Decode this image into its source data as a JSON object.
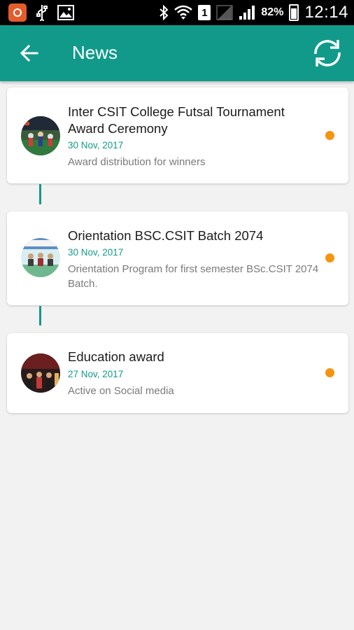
{
  "status_bar": {
    "sim_slot": "1",
    "battery": "82%",
    "time": "12:14"
  },
  "header": {
    "title": "News",
    "back_icon": "arrow-left-icon",
    "refresh_icon": "refresh-icon"
  },
  "colors": {
    "accent": "#119a8a",
    "unread_dot": "#f5940f"
  },
  "news": [
    {
      "title": "Inter CSIT College Futsal Tournament Award Ceremony",
      "date": "30 Nov, 2017",
      "description": "Award distribution for winners"
    },
    {
      "title": "Orientation BSC.CSIT Batch 2074",
      "date": "30 Nov, 2017",
      "description": "Orientation Program for first semester BSc.CSIT 2074 Batch."
    },
    {
      "title": "Education award",
      "date": "27 Nov, 2017",
      "description": "Active on Social media"
    }
  ]
}
